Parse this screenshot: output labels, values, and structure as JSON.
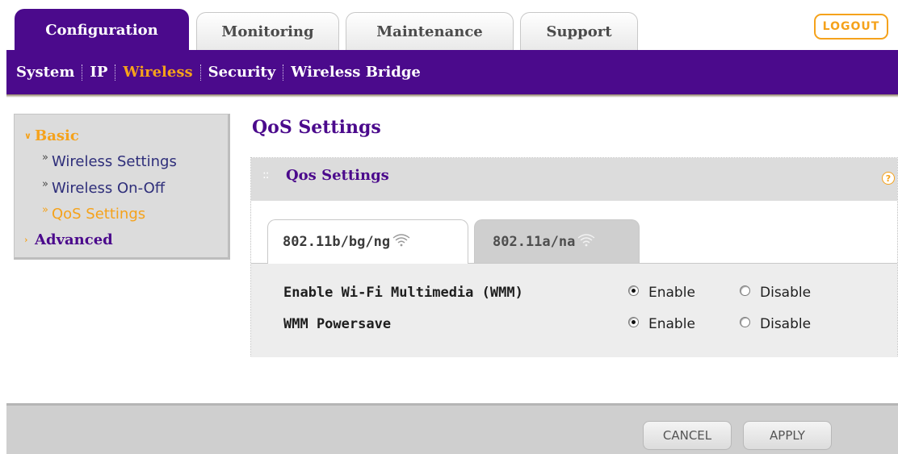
{
  "top_tabs": [
    {
      "label": "Configuration",
      "active": true
    },
    {
      "label": "Monitoring",
      "active": false
    },
    {
      "label": "Maintenance",
      "active": false
    },
    {
      "label": "Support",
      "active": false
    }
  ],
  "logout_label": "LOGOUT",
  "subnav": [
    {
      "label": "System"
    },
    {
      "label": "IP"
    },
    {
      "label": "Wireless",
      "active": true
    },
    {
      "label": "Security"
    },
    {
      "label": "Wireless Bridge"
    }
  ],
  "leftmenu": {
    "basic_label": "Basic",
    "basic_items": [
      {
        "label": "Wireless Settings"
      },
      {
        "label": "Wireless On-Off"
      },
      {
        "label": "QoS Settings",
        "current": true
      }
    ],
    "advanced_label": "Advanced"
  },
  "page_title": "QoS Settings",
  "panel": {
    "title": "Qos Settings",
    "help_glyph": "?",
    "band_tabs": [
      {
        "label": "802.11b/bg/ng",
        "active": true
      },
      {
        "label": "802.11a/na",
        "active": false
      }
    ],
    "options": [
      {
        "label": "Enable Wi-Fi Multimedia (WMM)",
        "enable": "Enable",
        "disable": "Disable",
        "selected": "Enable"
      },
      {
        "label": "WMM Powersave",
        "enable": "Enable",
        "disable": "Disable",
        "selected": "Enable"
      }
    ]
  },
  "buttons": {
    "cancel": "CANCEL",
    "apply": "APPLY"
  },
  "colors": {
    "brand_purple": "#4b0a8c",
    "accent_orange": "#f5a21b",
    "panel_gray": "#dcdcdc"
  },
  "icons": [
    "wifi-icon",
    "help-icon",
    "chevron-icon",
    "arrow-icon"
  ]
}
